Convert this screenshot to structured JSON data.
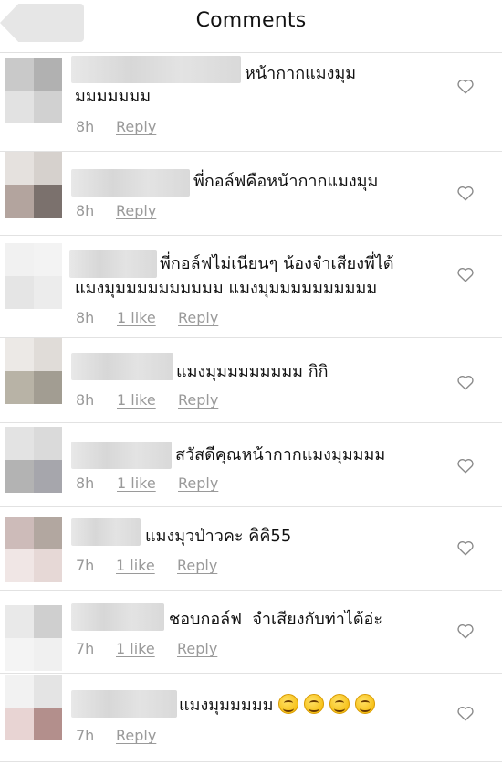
{
  "header": {
    "title": "Comments"
  },
  "comments": [
    {
      "line1": "หน้ากากแมงมุม",
      "line2": "มมมมมมม",
      "time": "8h",
      "reply": "Reply"
    },
    {
      "line1": "พี่กอล์ฟคือหน้ากากแมงมุม",
      "time": "8h",
      "reply": "Reply"
    },
    {
      "line1": "พี่กอล์ฟไม่เนียนๆ น้องจำเสียงพี่ได้",
      "line2": "แมงมุมมมมมมมมมม แมงมุมมมมมมมมมม",
      "time": "8h",
      "likes": "1 like",
      "reply": "Reply"
    },
    {
      "line1": "แมงมุมมมมมมมม กิกิ",
      "time": "8h",
      "likes": "1 like",
      "reply": "Reply"
    },
    {
      "line1": "สวัสดีคุณหน้ากากแมงมุมมมม",
      "time": "8h",
      "likes": "1 like",
      "reply": "Reply"
    },
    {
      "line1": "แมงมุวป่าวคะ คิคิ55",
      "time": "7h",
      "likes": "1 like",
      "reply": "Reply"
    },
    {
      "line1": "ชอบกอล์ฟ  จำเสียงกับท่าได้อ่ะ",
      "time": "7h",
      "likes": "1 like",
      "reply": "Reply"
    },
    {
      "line1": "แมงมุมมมมม",
      "time": "7h",
      "reply": "Reply"
    }
  ],
  "icons": {
    "back": "back-arrow-icon",
    "heart": "heart-outline-icon",
    "emoji": "smiling-face-emoji"
  },
  "colors": {
    "meta": "#999999",
    "divider": "#e2e2e2",
    "back_button": "#e6e6e6"
  }
}
